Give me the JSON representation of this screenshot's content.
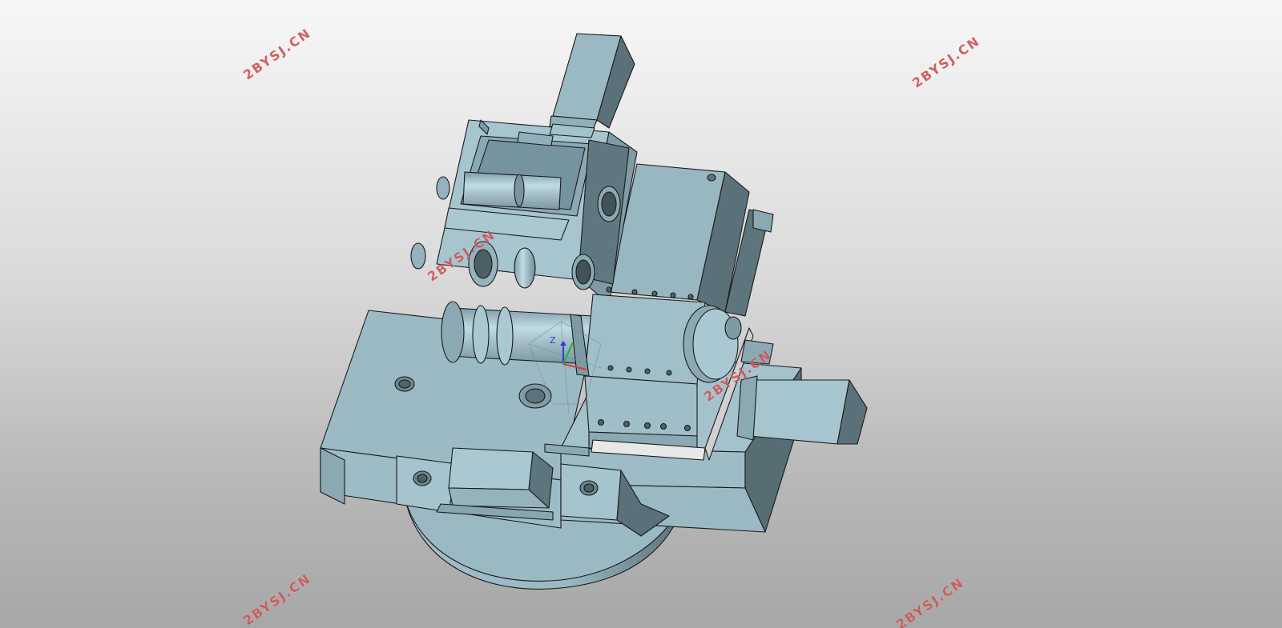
{
  "viewport": {
    "description_label": "",
    "background_colors": [
      "#f7f7f7",
      "#a7a7a7"
    ]
  },
  "model": {
    "color_light": "#a3c3cc",
    "color_mid": "#8fb0ba",
    "color_dark": "#5f7880",
    "edge_color": "#1a1a1a",
    "triad_labels": {
      "z": "Z"
    }
  },
  "watermarks": [
    "2BYSJ.CN",
    "2BYSJ.CN",
    "2BYSJ.CN",
    "2BYSJ.CN",
    "2BYSJ.CN",
    "2BYSJ.CN",
    "2BYSJ.CN"
  ]
}
